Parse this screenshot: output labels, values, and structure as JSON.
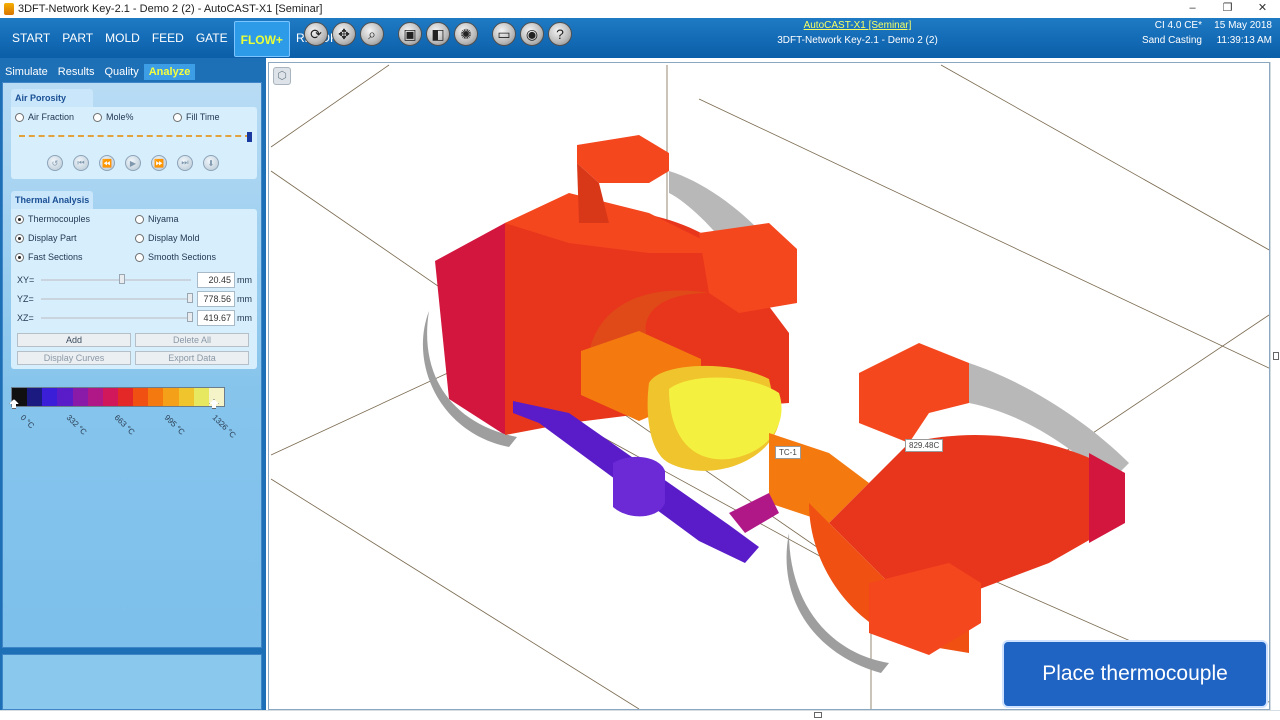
{
  "window": {
    "title": "3DFT-Network Key-2.1 - Demo 2 (2) - AutoCAST-X1 [Seminar]",
    "minimize": "–",
    "maximize": "❐",
    "close": "✕"
  },
  "menu": [
    {
      "label": "START",
      "active": false
    },
    {
      "label": "PART",
      "active": false
    },
    {
      "label": "MOLD",
      "active": false
    },
    {
      "label": "FEED",
      "active": false
    },
    {
      "label": "GATE",
      "active": false
    },
    {
      "label": "FLOW+",
      "active": true
    },
    {
      "label": "REPORT",
      "active": false
    }
  ],
  "toolbar_icons": [
    "rotate-icon",
    "pan-icon",
    "zoom-icon",
    "view-fit-icon",
    "render-mode-icon",
    "lighting-icon",
    "section-icon",
    "camera-icon",
    "help-icon"
  ],
  "header": {
    "license_link": "AutoCAST-X1 [Seminar]",
    "project": "3DFT-Network Key-2.1 - Demo 2 (2)",
    "material": "CI 4.0 CE*",
    "process": "Sand Casting",
    "date": "15 May 2018",
    "time": "11:39:13 AM"
  },
  "panel_tabs": [
    {
      "label": "Simulate",
      "active": false
    },
    {
      "label": "Results",
      "active": false
    },
    {
      "label": "Quality",
      "active": false
    },
    {
      "label": "Analyze",
      "active": true
    }
  ],
  "air_porosity": {
    "title": "Air Porosity",
    "options": [
      {
        "label": "Air Fraction",
        "selected": false
      },
      {
        "label": "Mole%",
        "selected": false
      },
      {
        "label": "Fill Time",
        "selected": false
      }
    ],
    "playback_progress": 1.0
  },
  "thermal_analysis": {
    "title": "Thermal Analysis",
    "options": [
      {
        "label": "Thermocouples",
        "selected": true
      },
      {
        "label": "Niyama",
        "selected": false
      },
      {
        "label": "Display Part",
        "selected": true
      },
      {
        "label": "Display Mold",
        "selected": false
      },
      {
        "label": "Fast Sections",
        "selected": true
      },
      {
        "label": "Smooth Sections",
        "selected": false
      }
    ],
    "sections": [
      {
        "axis": "XY=",
        "value": "20.45",
        "unit": "mm",
        "level": 0.5
      },
      {
        "axis": "YZ=",
        "value": "778.56",
        "unit": "mm",
        "level": 1.0
      },
      {
        "axis": "XZ=",
        "value": "419.67",
        "unit": "mm",
        "level": 1.0
      }
    ],
    "buttons": {
      "add": "Add",
      "delete_all": "Delete All",
      "display_curves": "Display Curves",
      "export_data": "Export Data"
    }
  },
  "color_scale": {
    "colors": [
      "#101010",
      "#1a1a80",
      "#3a1ed8",
      "#5a1cc8",
      "#8a1aa8",
      "#b01888",
      "#d0185a",
      "#e42828",
      "#f05012",
      "#f47a10",
      "#f4a018",
      "#f0c42c",
      "#e8e860",
      "#f4f4c8"
    ],
    "labels": [
      "0 °C",
      "332 °C",
      "663 °C",
      "995 °C",
      "1326 °C"
    ]
  },
  "viewport": {
    "thermocouple_name": "TC-1",
    "thermocouple_reading": "829.48C",
    "callout": "Place thermocouple",
    "view_cube_icon": "cube-icon"
  }
}
